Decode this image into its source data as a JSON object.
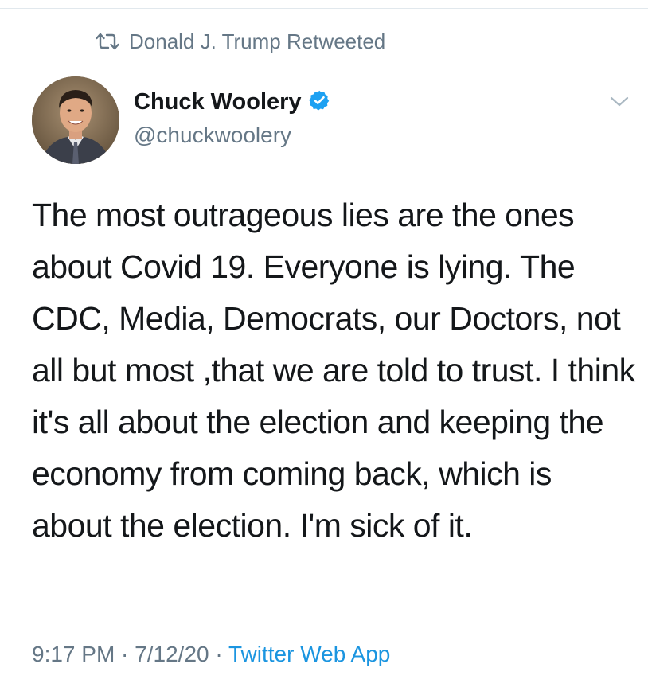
{
  "retweet": {
    "label": "Donald J. Trump Retweeted",
    "icon": "retweet-icon"
  },
  "author": {
    "display_name": "Chuck Woolery",
    "handle": "@chuckwoolery",
    "verified": true,
    "verified_icon": "verified-badge-icon",
    "verified_color": "#1da1f2"
  },
  "tweet": {
    "text": "The most outrageous lies are the ones about Covid 19. Everyone is lying. The CDC, Media, Democrats, our Doctors, not all but most ,that we are told to trust. I think it's all about the election and keeping the economy from coming back, which is about the election. I'm sick of it."
  },
  "meta": {
    "time": "9:17 PM",
    "separator1": " · ",
    "date": "7/12/20",
    "separator2": " · ",
    "source": "Twitter Web App"
  },
  "colors": {
    "text": "#14171a",
    "secondary": "#657786",
    "link": "#1b95e0"
  }
}
